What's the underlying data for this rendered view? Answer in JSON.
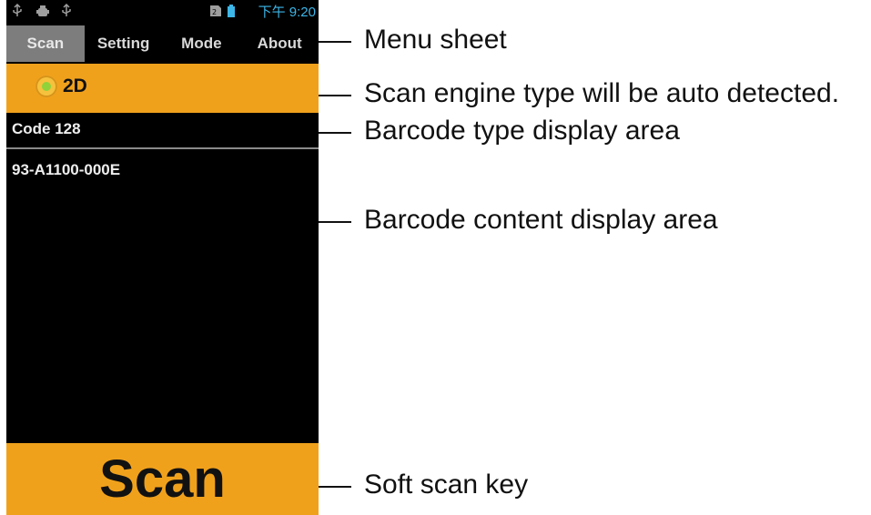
{
  "status_bar": {
    "icons": [
      "usb-icon",
      "android-debug-icon",
      "usb-icon",
      "sim-card-icon",
      "battery-icon"
    ],
    "time": "下午 9:20"
  },
  "tabs": [
    {
      "label": "Scan",
      "active": true
    },
    {
      "label": "Setting",
      "active": false
    },
    {
      "label": "Mode",
      "active": false
    },
    {
      "label": "About",
      "active": false
    }
  ],
  "engine": {
    "label": "2D",
    "indicator_color": "#8fd23a"
  },
  "barcode": {
    "type": "Code 128",
    "content": "93-A1100-000E"
  },
  "scan_button": {
    "label": "Scan"
  },
  "colors": {
    "accent": "#f0a11c",
    "background": "#000000",
    "time_color": "#3db6e8"
  },
  "callouts": {
    "menu_sheet": "Menu sheet",
    "engine_type": "Scan engine type will be auto detected.",
    "barcode_type": "Barcode type display area",
    "barcode_content": "Barcode content display area",
    "soft_scan_key": "Soft scan key"
  }
}
